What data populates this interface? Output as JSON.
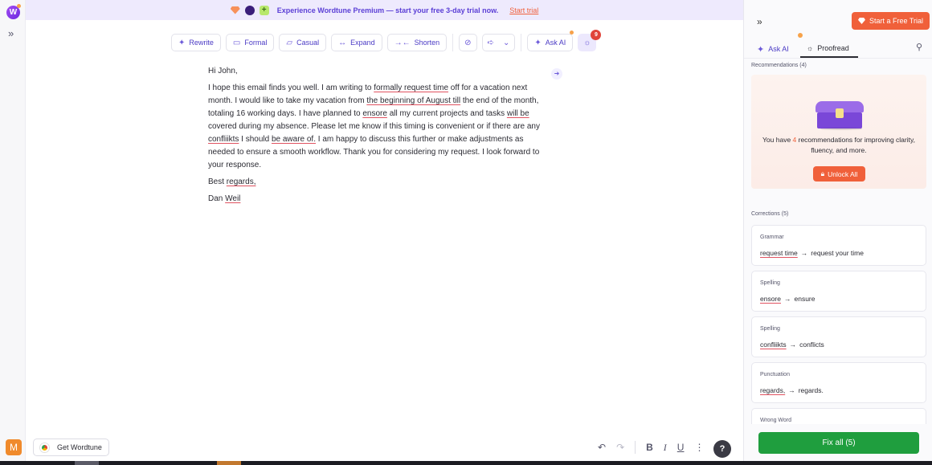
{
  "banner": {
    "text": "Experience Wordtune Premium — start your free 3-day trial now.",
    "link": "Start trial"
  },
  "toolbar": {
    "rewrite": "Rewrite",
    "formal": "Formal",
    "casual": "Casual",
    "expand": "Expand",
    "shorten": "Shorten",
    "ask_ai": "Ask AI",
    "badge_count": "9"
  },
  "editor": {
    "greeting": "Hi John,",
    "body": [
      {
        "t": "I hope this email finds you well. I am writing to ",
        "f": false
      },
      {
        "t": "formally request time",
        "f": true
      },
      {
        "t": " off for a vacation next month. I would like to take my vacation from ",
        "f": false
      },
      {
        "t": "the beginning of August till",
        "f": true
      },
      {
        "t": " the end of the month, totaling 16 working days. I have planned to ",
        "f": false
      },
      {
        "t": "ensore",
        "f": true
      },
      {
        "t": " all my current projects and tasks ",
        "f": false
      },
      {
        "t": "will be",
        "f": true
      },
      {
        "t": " covered during my absence. Please let me know if this timing is convenient or if there are any ",
        "f": false
      },
      {
        "t": "confliikts",
        "f": true
      },
      {
        "t": " I should ",
        "f": false
      },
      {
        "t": "be aware of.",
        "f": true
      },
      {
        "t": " I am happy to discuss this further or make adjustments as needed to ensure a smooth workflow. Thank you for considering my request. I look forward to your response.",
        "f": false
      }
    ],
    "closing_prefix": "Best ",
    "closing_flag": "regards,",
    "sig_prefix": "Dan ",
    "sig_flag": "Weil"
  },
  "bottom": {
    "get_wordtune": "Get Wordtune",
    "avatar": "M",
    "help": "?",
    "bold": "B",
    "italic": "I",
    "underline": "U"
  },
  "panel": {
    "start_trial": "Start a Free Trial",
    "tab_ask_ai": "Ask AI",
    "tab_proofread": "Proofread",
    "recommendations_title": "Recommendations (4)",
    "reco_msg_prefix": "You have ",
    "reco_count": "4",
    "reco_msg_suffix": " recommendations for improving clarity, fluency, and more.",
    "unlock_all": "Unlock All",
    "corrections_title": "Corrections (5)",
    "corrections": [
      {
        "kind": "Grammar",
        "orig": "request time",
        "fix": "request your time"
      },
      {
        "kind": "Spelling",
        "orig": "ensore",
        "fix": "ensure"
      },
      {
        "kind": "Spelling",
        "orig": "confliikts",
        "fix": "conflicts"
      },
      {
        "kind": "Punctuation",
        "orig": "regards,",
        "fix": "regards."
      },
      {
        "kind": "Wrong Word",
        "orig": "",
        "fix": ""
      }
    ],
    "fix_all": "Fix all (5)",
    "arrow": "→"
  },
  "colors": {
    "accent": "#4b3bc5",
    "brand_orange": "#f0603a",
    "fix_green": "#1f9e3e",
    "error_underline": "#e05260"
  }
}
